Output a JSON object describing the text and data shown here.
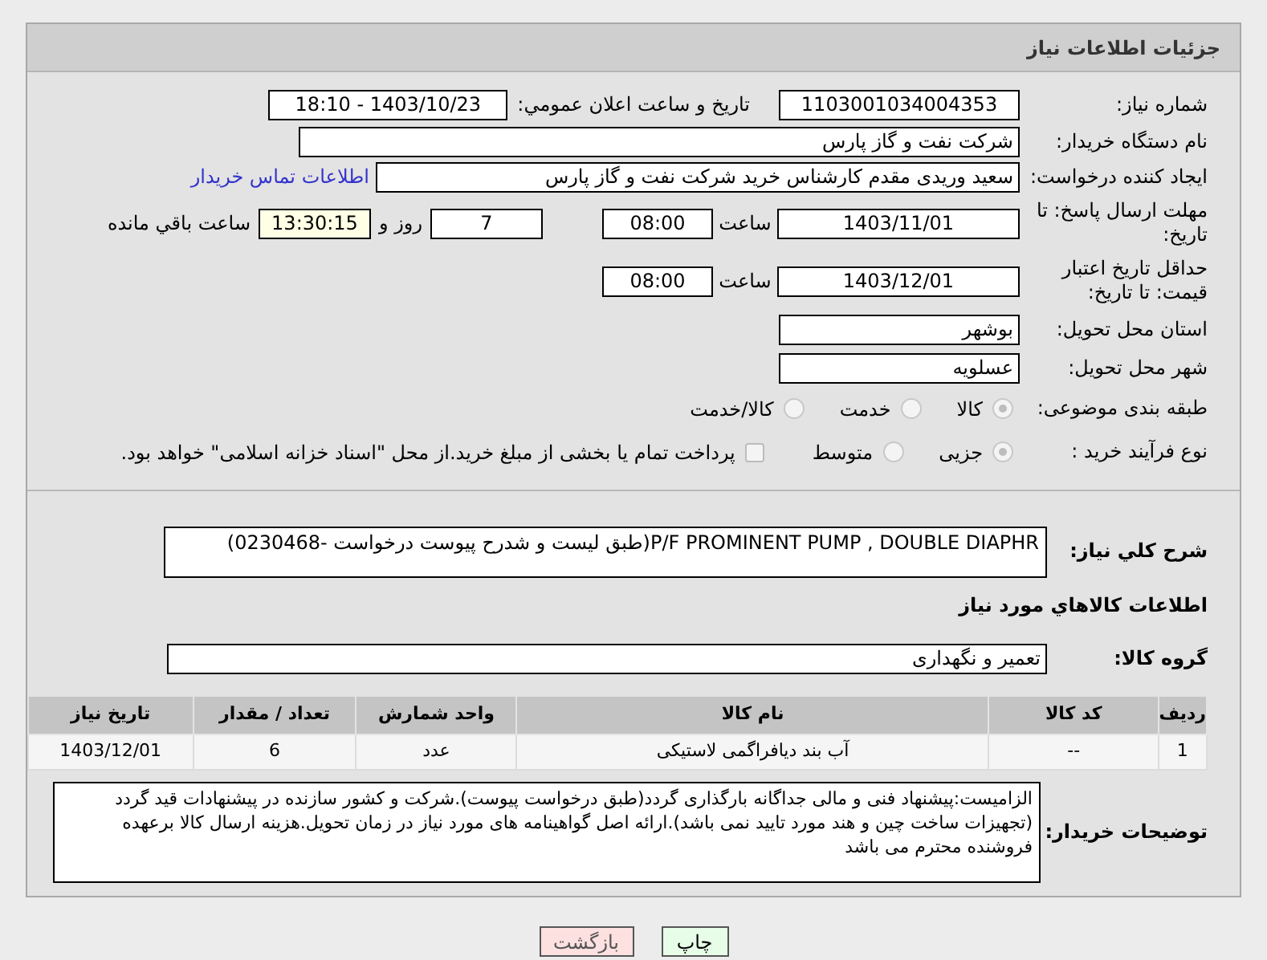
{
  "header": {
    "title": "جزئیات اطلاعات نیاز"
  },
  "need_number": {
    "label": "شماره نیاز:",
    "value": "1103001034004353"
  },
  "announce": {
    "label": "تاریخ و ساعت اعلان عمومي:",
    "value": "1403/10/23 - 18:10"
  },
  "buyer_org": {
    "label": "نام دستگاه خریدار:",
    "value": "شرکت نفت و گاز پارس"
  },
  "creator": {
    "label": "ایجاد کننده درخواست:",
    "value": "سعید وریدی مقدم کارشناس خرید شرکت نفت و گاز پارس",
    "link": "اطلاعات تماس خریدار"
  },
  "reply_deadline": {
    "label": "مهلت ارسال پاسخ: تا تاریخ:",
    "date": "1403/11/01",
    "time_label": "ساعت",
    "time": "08:00",
    "days": "7",
    "days_label": "روز و",
    "remaining": "13:30:15",
    "remaining_label": "ساعت باقي مانده"
  },
  "price_validity": {
    "label": "حداقل تاریخ اعتبار قیمت: تا تاریخ:",
    "date": "1403/12/01",
    "time_label": "ساعت",
    "time": "08:00"
  },
  "province": {
    "label": "استان محل تحویل:",
    "value": "بوشهر"
  },
  "city": {
    "label": "شهر محل تحویل:",
    "value": "عسلویه"
  },
  "category": {
    "label": "طبقه بندی موضوعی:",
    "options": [
      {
        "label": "کالا",
        "selected": true
      },
      {
        "label": "خدمت",
        "selected": false
      },
      {
        "label": "کالا/خدمت",
        "selected": false
      }
    ]
  },
  "purchase_type": {
    "label": "نوع فرآیند خرید :",
    "options": [
      {
        "label": "جزیی",
        "selected": true
      },
      {
        "label": "متوسط",
        "selected": false
      }
    ],
    "treasury": {
      "label": "پرداخت تمام یا بخشی از مبلغ خرید.از محل \"اسناد خزانه اسلامی\" خواهد بود.",
      "checked": false
    }
  },
  "summary": {
    "label": "شرح کلي نیاز:",
    "value": "P/F PROMINENT PUMP , DOUBLE DIAPHR(طبق لیست و شدرح پیوست درخواست -0230468)"
  },
  "goods_heading": "اطلاعات کالاهاي مورد نیاز",
  "goods_group": {
    "label": "گروه کالا:",
    "value": "تعمیر و نگهداری"
  },
  "table": {
    "columns": [
      "ردیف",
      "کد کالا",
      "نام کالا",
      "واحد شمارش",
      "تعداد / مقدار",
      "تاریخ نیاز"
    ],
    "rows": [
      [
        "1",
        "--",
        "آب بند دیافراگمی لاستیکی",
        "عدد",
        "6",
        "1403/12/01"
      ]
    ]
  },
  "buyer_notes": {
    "label": "توضیحات خریدار:",
    "value": "الزامیست:پیشنهاد فنی و مالی  جداگانه بارگذاری گردد(طبق درخواست پیوست).شرکت و کشور سازنده در پیشنهادات قید گردد (تجهیزات ساخت چین و هند مورد تایید نمی باشد).ارائه اصل گواهینامه های مورد نیاز در زمان تحویل.هزینه ارسال کالا برعهده فروشنده محترم می باشد"
  },
  "buttons": [
    {
      "label": "چاپ",
      "kind": "print"
    },
    {
      "label": "بازگشت",
      "kind": "back"
    }
  ]
}
